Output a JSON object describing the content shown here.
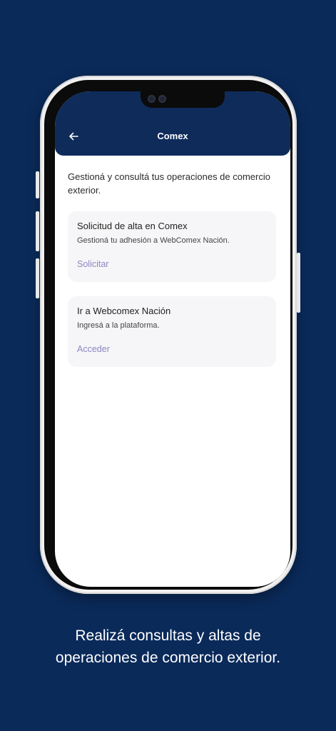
{
  "header": {
    "title": "Comex",
    "back_icon": "arrow-left-icon"
  },
  "intro": "Gestioná y consultá tus operaciones de comercio exterior.",
  "cards": [
    {
      "title": "Solicitud de alta en Comex",
      "subtitle": "Gestioná tu adhesión a WebComex Nación.",
      "action": "Solicitar"
    },
    {
      "title": "Ir a Webcomex Nación",
      "subtitle": "Ingresá a la plataforma.",
      "action": "Acceder"
    }
  ],
  "caption": {
    "line1": "Realizá consultas y altas de",
    "line2": "operaciones de comercio exterior."
  },
  "colors": {
    "background": "#0a2a5a",
    "appbar": "#0e2b5a",
    "accent": "#8c86c1",
    "card": "#f6f6f8"
  }
}
